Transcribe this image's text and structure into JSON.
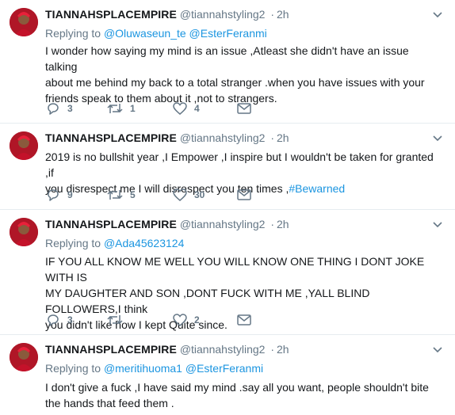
{
  "colors": {
    "link": "#1b95e0",
    "muted": "#657786",
    "avatar_bg": "#b01627"
  },
  "tweets": [
    {
      "name": "TIANNAHSPLACEMPIRE",
      "handle": "@tiannahstyling2",
      "dot": "·",
      "time": "2h",
      "replying_prefix": "Replying to",
      "replying_to_1": "@Oluwaseun_te",
      "replying_to_2": "@EsterFeranmi",
      "text": "I wonder how saying my mind is an issue ,Atleast she didn't have an issue talking\nabout me behind my back to a total stranger .when you have issues with your\nfriends speak to them about it ,not to strangers.",
      "replies": "3",
      "retweets": "1",
      "likes": "4"
    },
    {
      "name": "TIANNAHSPLACEMPIRE",
      "handle": "@tiannahstyling2",
      "dot": "·",
      "time": "2h",
      "text": "2019 is no bullshit year ,I Empower ,I inspire but I wouldn't be taken for granted ,if\nyou disrespect me I will disrespect you ten times ,",
      "hashtag": "#Bewarned",
      "replies": "9",
      "retweets": "5",
      "likes": "30"
    },
    {
      "name": "TIANNAHSPLACEMPIRE",
      "handle": "@tiannahstyling2",
      "dot": "·",
      "time": "2h",
      "replying_prefix": "Replying to",
      "replying_to_1": "@Ada45623124",
      "text": "IF YOU ALL KNOW ME WELL YOU WILL KNOW ONE THING I DONT JOKE WITH IS\nMY DAUGHTER AND SON ,DONT FUCK WITH ME ,YALL BLIND FOLLOWERS,I think\nyou didn't like how I kept Quite since.",
      "replies": "3",
      "retweets": "",
      "likes": "2"
    },
    {
      "name": "TIANNAHSPLACEMPIRE",
      "handle": "@tiannahstyling2",
      "dot": "·",
      "time": "2h",
      "replying_prefix": "Replying to",
      "replying_to_1": "@meritihuoma1",
      "replying_to_2": "@EsterFeranmi",
      "text": "I don't give a fuck ,I have said my mind .say all you want, people shouldn't bite\nthe hands that feed them ."
    }
  ]
}
